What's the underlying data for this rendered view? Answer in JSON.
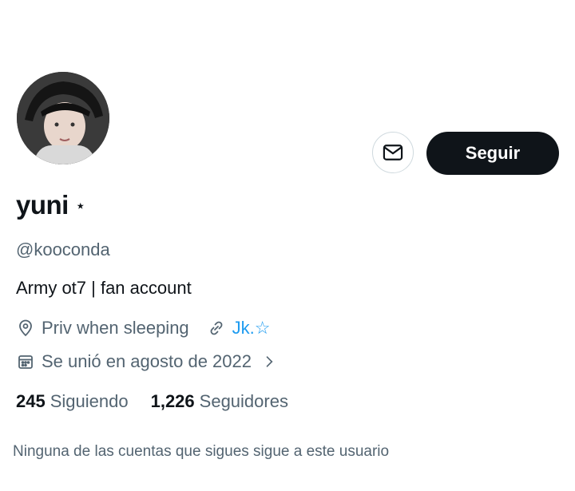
{
  "profile": {
    "name": "yuni",
    "name_badge": "⋆",
    "handle": "@kooconda",
    "bio": "Army ot7 | fan account",
    "location": "Priv when sleeping",
    "link": "Jk.☆",
    "joined": "Se unió en agosto de 2022"
  },
  "actions": {
    "follow_label": "Seguir"
  },
  "stats": {
    "following_count": "245",
    "following_label": "Siguiendo",
    "followers_count": "1,226",
    "followers_label": "Seguidores"
  },
  "footer": {
    "no_common_followers": "Ninguna de las cuentas que sigues sigue a este usuario"
  },
  "colors": {
    "accent": "#1d9bf0",
    "primary_text": "#0f1419",
    "secondary_text": "#536471",
    "button_bg": "#0f1419"
  },
  "icons": {
    "message": "envelope-icon",
    "location": "location-pin-icon",
    "link": "link-icon",
    "calendar": "calendar-icon",
    "chevron": "chevron-right-icon"
  }
}
